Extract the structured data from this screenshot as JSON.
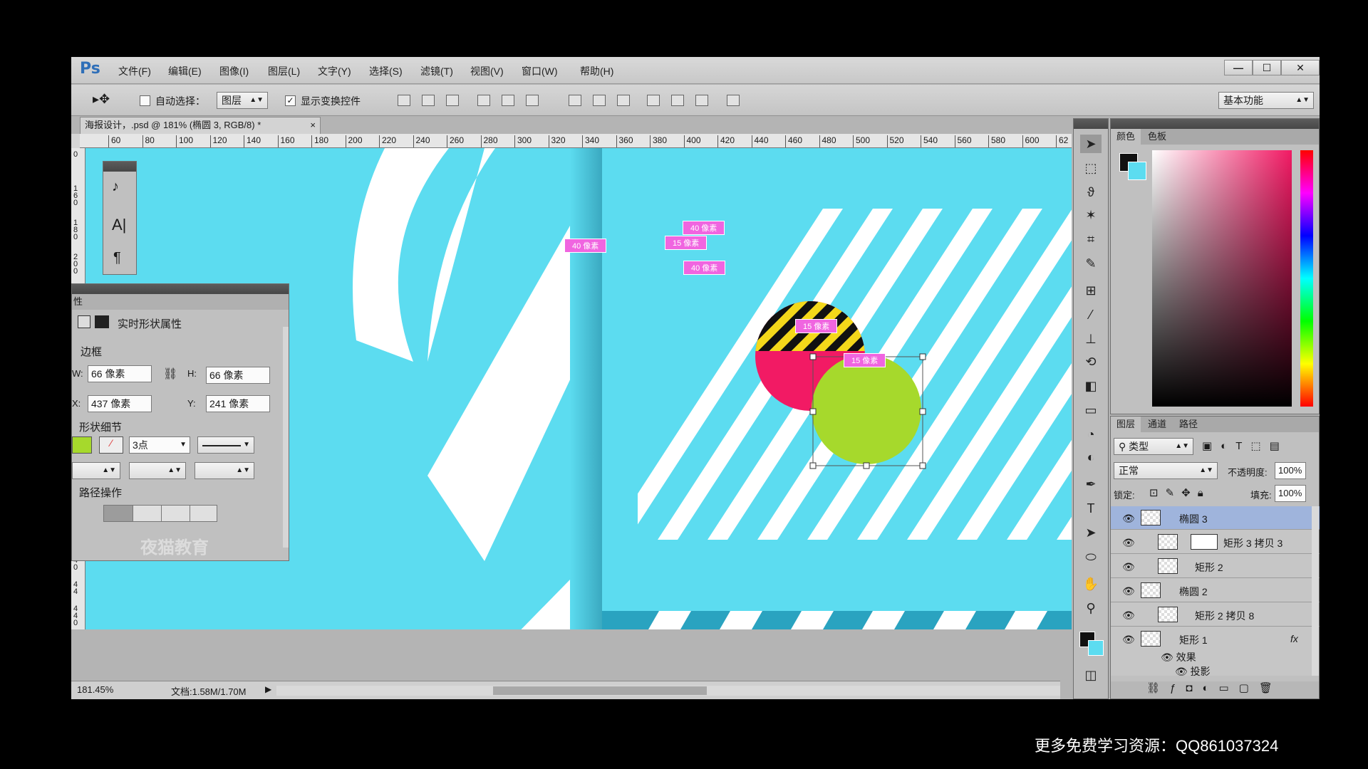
{
  "app": {
    "logo": "Ps",
    "menus": [
      "文件(F)",
      "编辑(E)",
      "图像(I)",
      "图层(L)",
      "文字(Y)",
      "选择(S)",
      "滤镜(T)",
      "视图(V)",
      "窗口(W)",
      "帮助(H)"
    ],
    "window_buttons": [
      "—",
      "☐",
      "✕"
    ]
  },
  "options": {
    "auto_select_label": "自动选择：",
    "auto_select_value": "图层",
    "show_transform_label": "显示变换控件",
    "workspace": "基本功能"
  },
  "document": {
    "tab_title": "海报设计，.psd @ 181% (椭圆 3, RGB/8) *",
    "tab_close": "×"
  },
  "ruler": {
    "h_ticks": [
      "60",
      "80",
      "100",
      "120",
      "140",
      "160",
      "180",
      "200",
      "220",
      "240",
      "260",
      "280",
      "300",
      "320",
      "340",
      "360",
      "380",
      "400",
      "420",
      "440",
      "460",
      "480",
      "500",
      "520",
      "540",
      "560",
      "580",
      "600",
      "62"
    ],
    "v_ticks_top": [
      "0",
      "1 6 0",
      "1 8 0",
      "2 0 0"
    ],
    "v_ticks_bottom": [
      "0",
      "4 0",
      "4 4",
      "4 4 0"
    ]
  },
  "canvas": {
    "measure_labels": [
      "40 像素",
      "40 像素",
      "15 像素",
      "40 像素",
      "15 像素",
      "15 像素"
    ]
  },
  "status": {
    "zoom": "181.45%",
    "doc_info": "文档:1.58M/1.70M"
  },
  "properties": {
    "tab": "性",
    "title": "实时形状属性",
    "section_border": "边框",
    "w_label": "W:",
    "w_value": "66 像素",
    "h_label": "H:",
    "h_value": "66 像素",
    "x_label": "X:",
    "x_value": "437 像素",
    "y_label": "Y:",
    "y_value": "241 像素",
    "section_shape": "形状细节",
    "stroke_width": "3点",
    "section_path": "路径操作",
    "watermark": "夜猫教育"
  },
  "color_panel": {
    "tabs": [
      "颜色",
      "色板"
    ]
  },
  "layers_panel": {
    "tabs": [
      "图层",
      "通道",
      "路径"
    ],
    "filter": "类型",
    "blend_mode": "正常",
    "opacity_label": "不透明度:",
    "opacity_value": "100%",
    "lock_label": "锁定:",
    "fill_label": "填充:",
    "fill_value": "100%",
    "layers": [
      {
        "name": "椭圆 3",
        "selected": true
      },
      {
        "name": "矩形 3 拷贝 3",
        "selected": false
      },
      {
        "name": "矩形 2",
        "selected": false
      },
      {
        "name": "椭圆 2",
        "selected": false
      },
      {
        "name": "矩形 2 拷贝 8",
        "selected": false
      },
      {
        "name": "矩形 1",
        "selected": false
      }
    ],
    "effects_label": "效果",
    "shadow_label": "投影",
    "fx_label": "fx"
  },
  "colors": {
    "canvas": "#5cdcf0",
    "accent_pink": "#f065e0",
    "circle_pink": "#f21a64",
    "circle_lime": "#a6d92c",
    "stripe_yellow": "#f4d81a"
  },
  "caption": "更多免费学习资源：QQ861037324"
}
